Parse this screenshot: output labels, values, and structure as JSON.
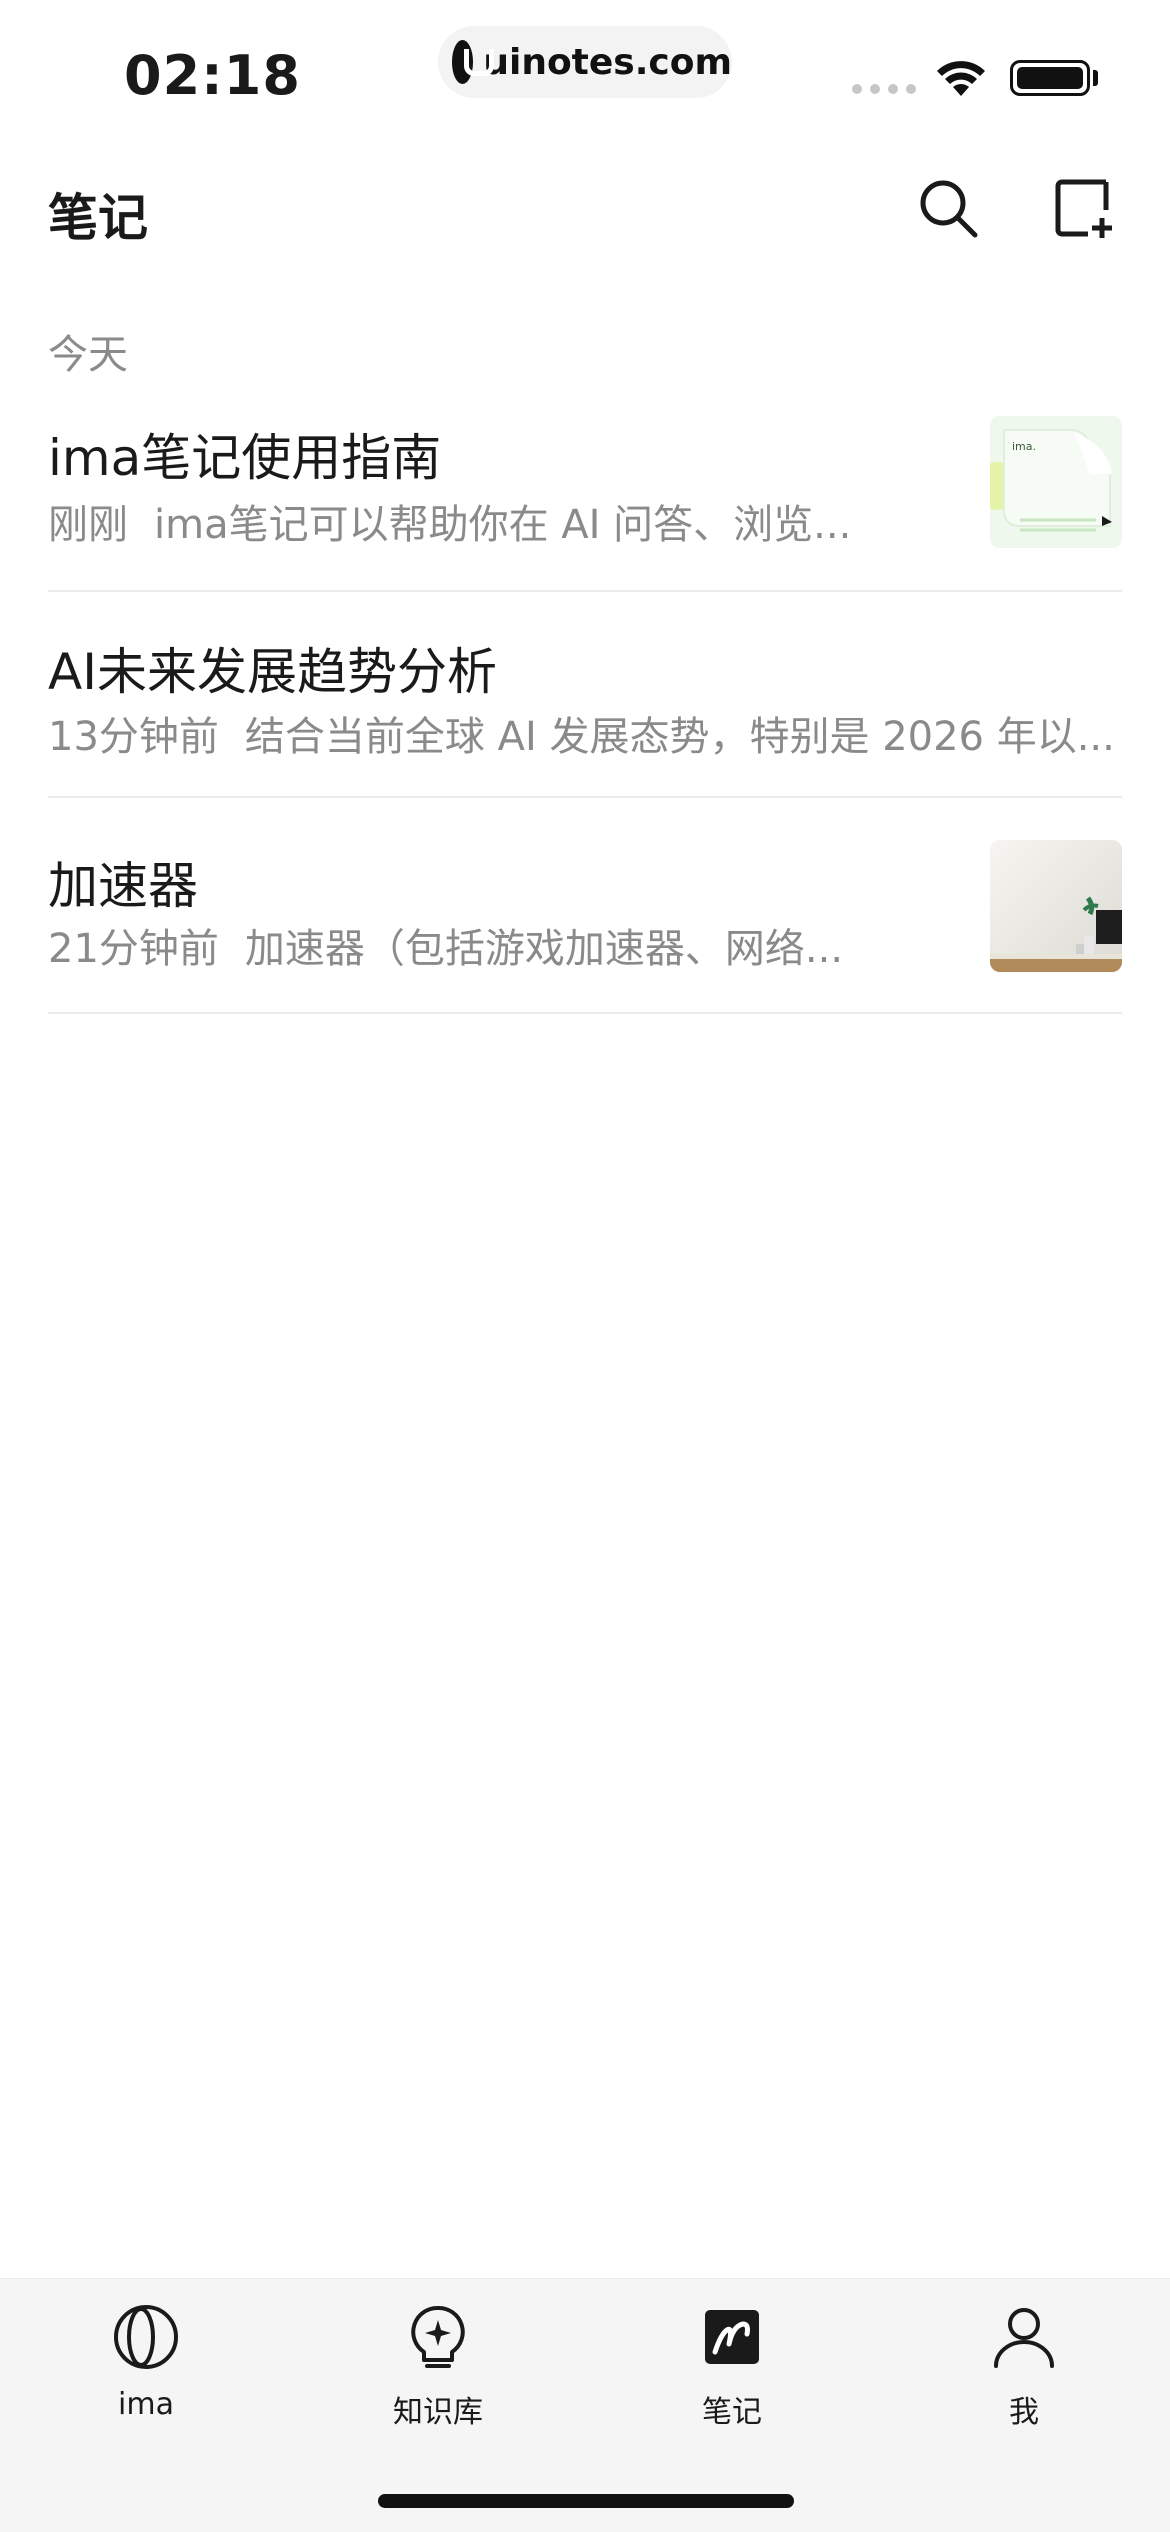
{
  "status_bar": {
    "time": "02:18",
    "site": "uinotes.com"
  },
  "header": {
    "title": "笔记",
    "search_icon": "search-icon",
    "new_note_icon": "new-note-icon"
  },
  "section": {
    "label": "今天"
  },
  "notes": [
    {
      "title": "ima笔记使用指南",
      "time_ago": "刚刚",
      "snippet": "ima笔记可以帮助你在 AI 问答、浏览...",
      "has_thumbnail": true
    },
    {
      "title": "AI未来发展趋势分析",
      "time_ago": "13分钟前",
      "snippet": "结合当前全球 AI 发展态势，特别是 2026 年以...",
      "has_thumbnail": false
    },
    {
      "title": "加速器",
      "time_ago": "21分钟前",
      "snippet": "加速器（包括游戏加速器、网络...",
      "has_thumbnail": true
    }
  ],
  "tab_bar": {
    "tabs": [
      {
        "label": "ima",
        "icon": "ima-icon"
      },
      {
        "label": "知识库",
        "icon": "knowledge-base-icon"
      },
      {
        "label": "笔记",
        "icon": "notes-icon",
        "active": true
      },
      {
        "label": "我",
        "icon": "profile-icon"
      }
    ]
  },
  "colors": {
    "background": "#ffffff",
    "text_primary": "#1a1a1a",
    "text_secondary": "#8a8a8a",
    "divider": "#ececec",
    "tab_bar_bg": "#f5f5f5"
  }
}
